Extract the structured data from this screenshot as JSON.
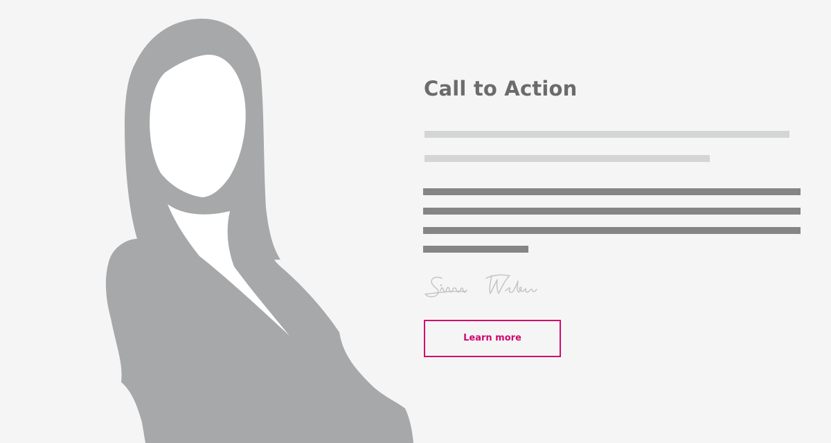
{
  "cta": {
    "title": "Call to Action",
    "button_label": "Learn more",
    "signature": "Simon Weber"
  },
  "colors": {
    "background": "#f5f5f5",
    "silhouette": "#a6a8a9",
    "title": "#6b6b6b",
    "subtitle_bars": "#d4d6d6",
    "body_bars": "#858585",
    "accent": "#d0086e",
    "signature": "#c2c2c2"
  }
}
